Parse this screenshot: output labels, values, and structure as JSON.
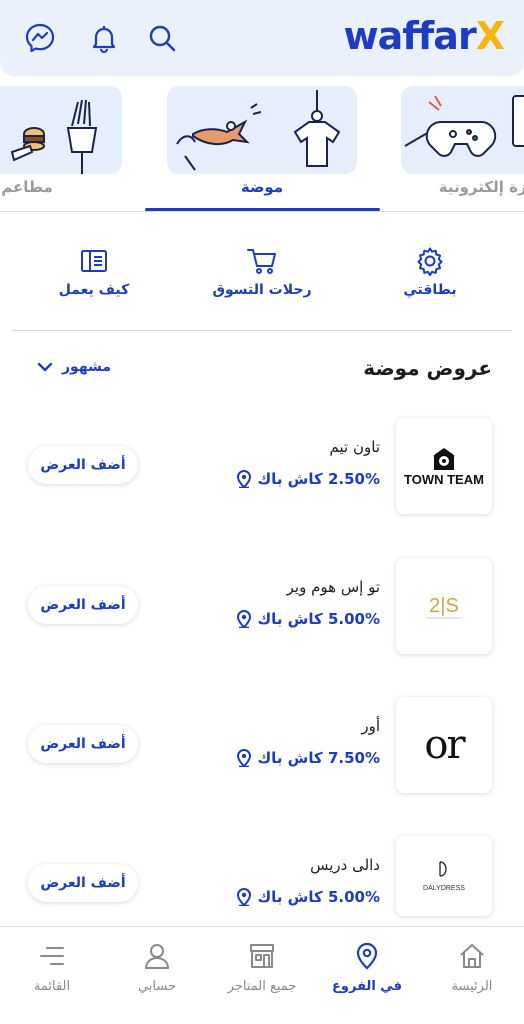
{
  "header": {
    "logo_main": "waffar",
    "logo_accent": "X"
  },
  "categories": [
    {
      "label": "مطاعم"
    },
    {
      "label": "موضة"
    },
    {
      "label": "أجهزة إلكترونية"
    }
  ],
  "quick_actions": [
    {
      "label": "بطاقتي",
      "icon": "gear-icon"
    },
    {
      "label": "رحلات التسوق",
      "icon": "cart-icon"
    },
    {
      "label": "كيف يعمل",
      "icon": "book-icon"
    }
  ],
  "section": {
    "title": "عروض موضة",
    "sort_label": "مشهور"
  },
  "offers": [
    {
      "name": "تاون تيم",
      "cashback": "2.50% كاش باك",
      "button": "أضف العرض",
      "brand": "TOWN TEAM"
    },
    {
      "name": "تو إس هوم وير",
      "cashback": "5.00% كاش باك",
      "button": "أضف العرض",
      "brand": "2|S"
    },
    {
      "name": "أور",
      "cashback": "7.50% كاش باك",
      "button": "أضف العرض",
      "brand": "or"
    },
    {
      "name": "دالى دريس",
      "cashback": "5.00% كاش باك",
      "button": "أضف العرض",
      "brand": "DALYDRESS"
    }
  ],
  "bottom_nav": [
    {
      "label": "الرئيسة",
      "icon": "home-icon"
    },
    {
      "label": "في الفروع",
      "icon": "location-pin-icon",
      "active": true
    },
    {
      "label": "جميع المتاجر",
      "icon": "store-icon"
    },
    {
      "label": "حسابي",
      "icon": "user-icon"
    },
    {
      "label": "القائمة",
      "icon": "menu-icon"
    }
  ],
  "colors": {
    "brand_blue": "#1e3bc4",
    "brand_yellow": "#f5b60a",
    "header_bg": "#eaf1fb"
  }
}
